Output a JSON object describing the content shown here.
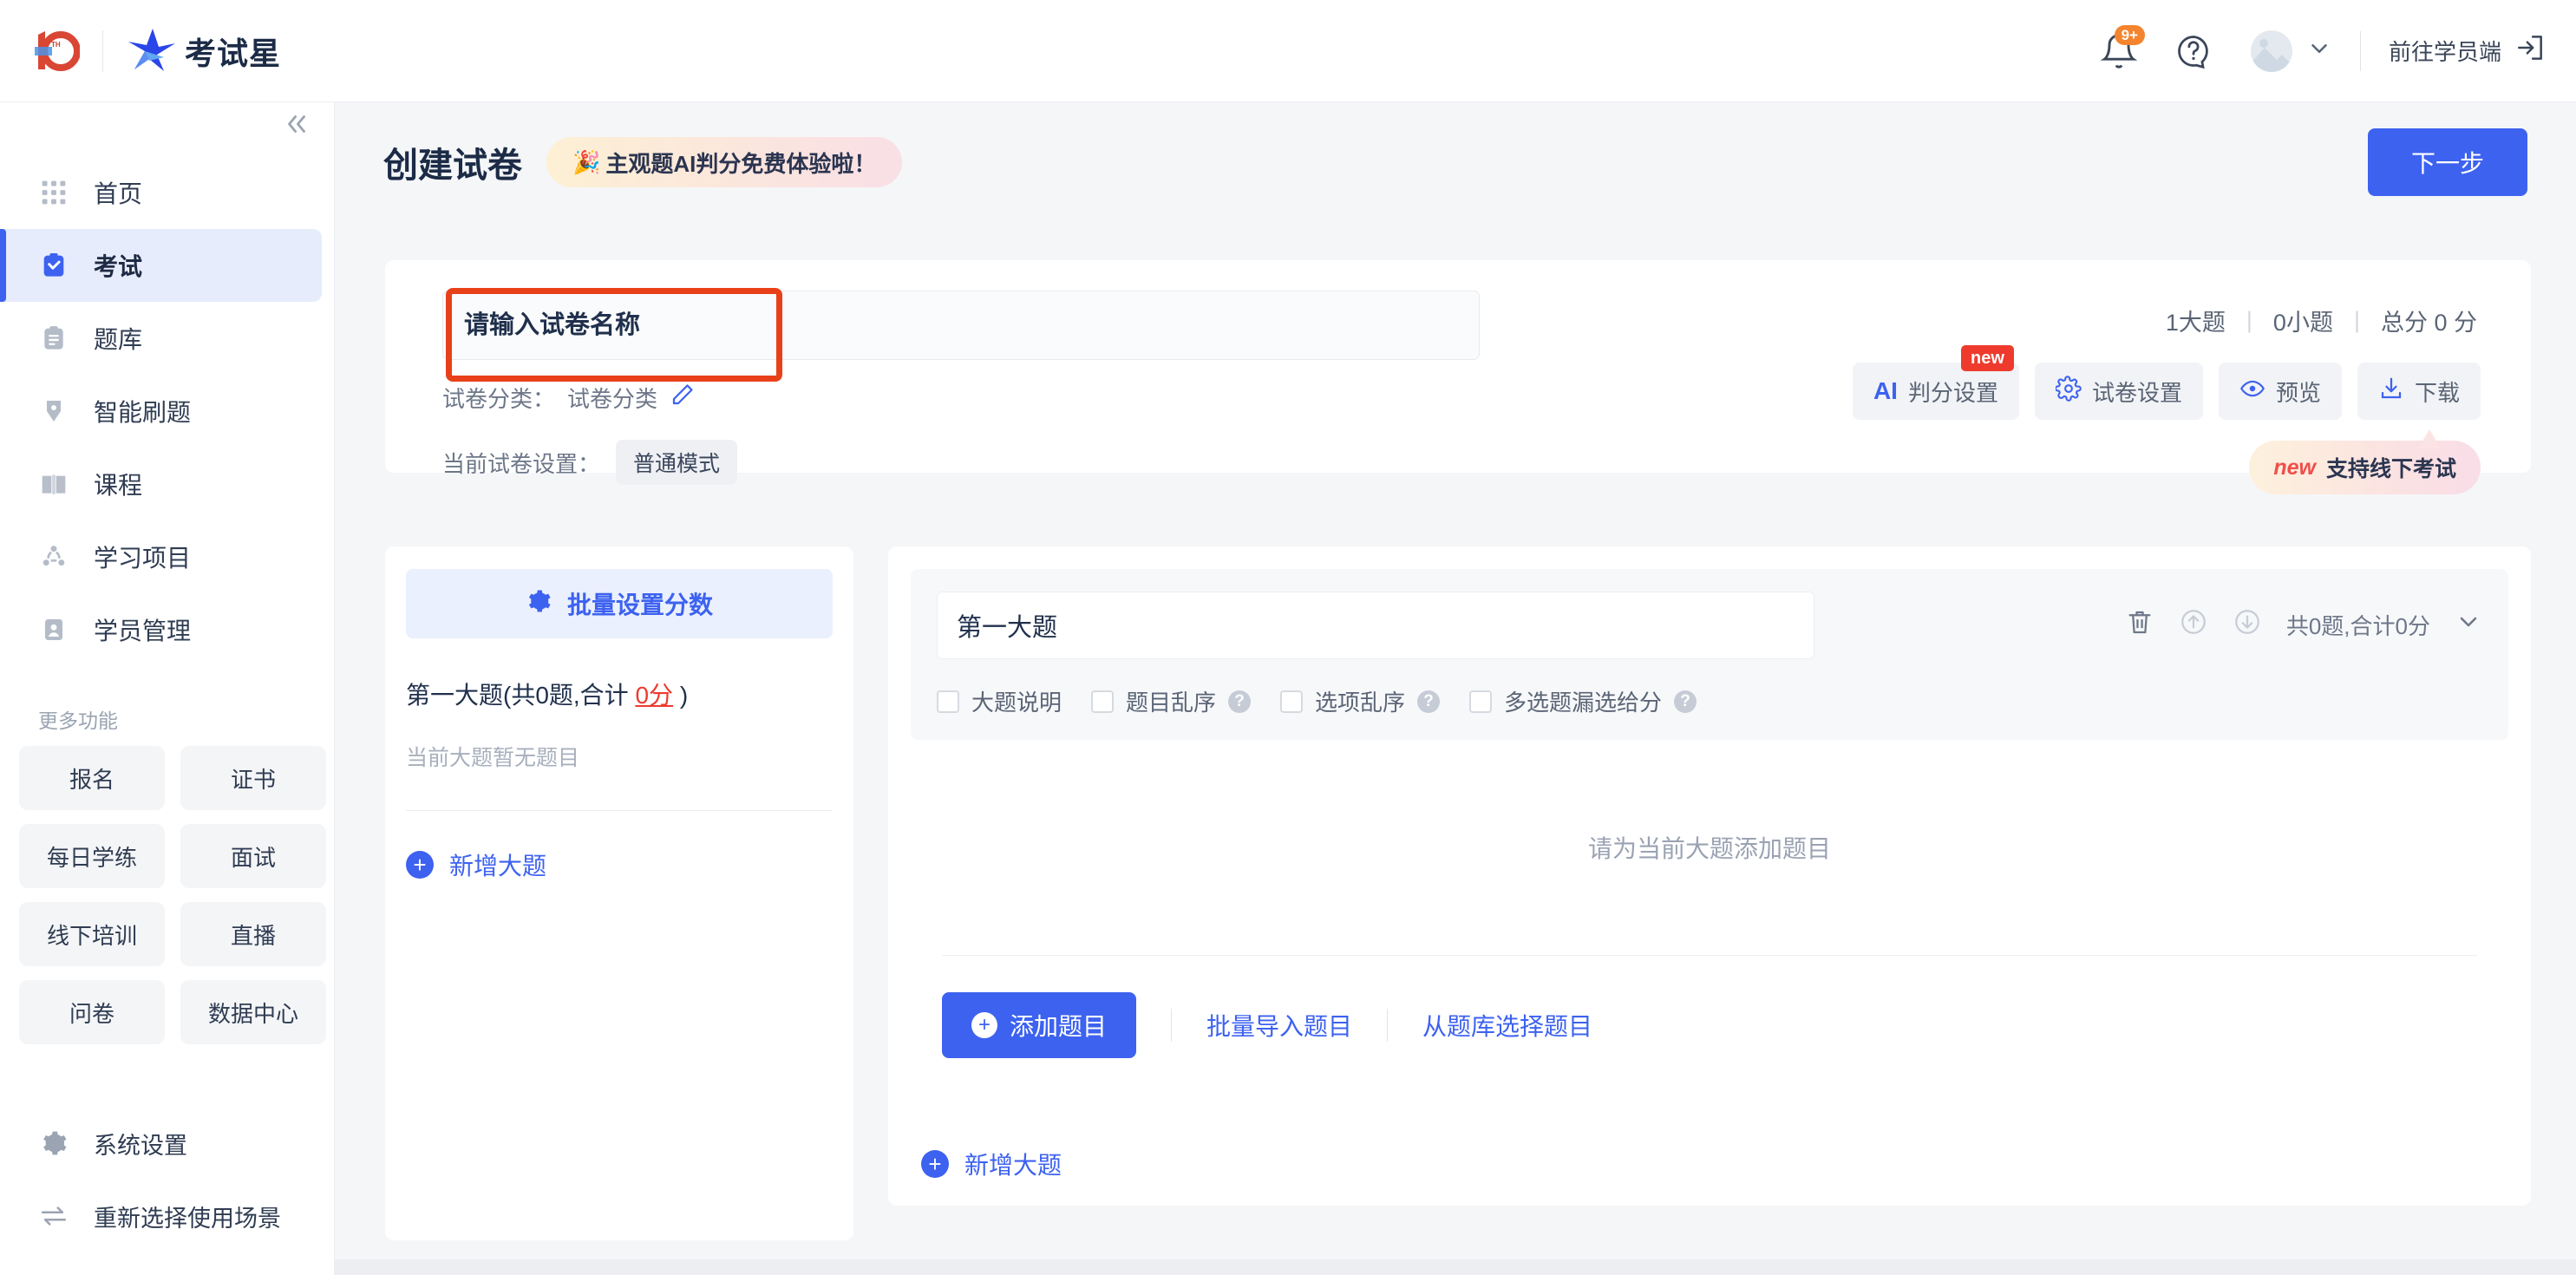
{
  "header": {
    "brand_name": "考试星",
    "logo_anniversary": "10",
    "logo_anniversary_sup": "TH",
    "notification_badge": "9+",
    "notification_icon": "bell-icon",
    "help_icon": "question-circle-icon",
    "avatar_icon": "avatar-placeholder",
    "account_chevron_icon": "chevron-down-icon",
    "goto_student_label": "前往学员端",
    "goto_student_icon": "exit-icon"
  },
  "sidebar": {
    "collapse_icon": "double-chevron-left-icon",
    "items": [
      {
        "label": "首页",
        "icon": "grid-icon",
        "active": false
      },
      {
        "label": "考试",
        "icon": "clipboard-check-icon",
        "active": true
      },
      {
        "label": "题库",
        "icon": "clipboard-lines-icon",
        "active": false
      },
      {
        "label": "智能刷题",
        "icon": "pen-nib-icon",
        "active": false
      },
      {
        "label": "课程",
        "icon": "book-open-icon",
        "active": false
      },
      {
        "label": "学习项目",
        "icon": "share-nodes-icon",
        "active": false
      },
      {
        "label": "学员管理",
        "icon": "id-card-icon",
        "active": false
      }
    ],
    "more_title": "更多功能",
    "chips": [
      "报名",
      "证书",
      "每日学练",
      "面试",
      "线下培训",
      "直播",
      "问卷",
      "数据中心"
    ],
    "bottom_links": [
      {
        "label": "系统设置",
        "icon": "gear-icon"
      },
      {
        "label": "重新选择使用场景",
        "icon": "swap-arrows-icon"
      }
    ]
  },
  "page": {
    "title": "创建试卷",
    "promo_icon": "party-popper-icon",
    "promo_text": "主观题AI判分免费体验啦！",
    "next_button": "下一步"
  },
  "paper": {
    "name_value": "",
    "name_placeholder": "请输入试卷名称",
    "category_label": "试卷分类：",
    "category_value": "试卷分类",
    "category_edit_icon": "pencil-icon",
    "settings_label": "当前试卷设置：",
    "settings_mode": "普通模式",
    "stats": {
      "sections": "1大题",
      "questions": "0小题",
      "total": "总分 0 分",
      "separator": "|"
    },
    "tools": [
      {
        "label": "判分设置",
        "icon": "ai-mark",
        "prefix": "AI",
        "badge": "new"
      },
      {
        "label": "试卷设置",
        "icon": "gear-icon",
        "prefix": "",
        "badge": ""
      },
      {
        "label": "预览",
        "icon": "eye-icon",
        "prefix": "",
        "badge": ""
      },
      {
        "label": "下载",
        "icon": "download-icon",
        "prefix": "",
        "badge": ""
      }
    ],
    "tip_new": "new",
    "tip_text": "支持线下考试"
  },
  "outline": {
    "batch_label": "批量设置分数",
    "batch_icon": "gear-icon",
    "section_head_prefix": "第一大题(共0题,合计 ",
    "section_head_score": "0分",
    "section_head_suffix": " )",
    "empty_text": "当前大题暂无题目",
    "add_section_label": "新增大题",
    "add_section_icon": "plus-circle-icon"
  },
  "editor": {
    "section_title_value": "第一大题",
    "delete_icon": "trash-icon",
    "move_up_icon": "arrow-up-circle-icon",
    "move_down_icon": "arrow-down-circle-icon",
    "section_summary": "共0题,合计0分",
    "collapse_icon": "chevron-down-icon",
    "checkboxes": [
      {
        "label": "大题说明",
        "help": false
      },
      {
        "label": "题目乱序",
        "help": true
      },
      {
        "label": "选项乱序",
        "help": true
      },
      {
        "label": "多选题漏选给分",
        "help": true
      }
    ],
    "empty_text": "请为当前大题添加题目",
    "add_question_label": "添加题目",
    "add_question_icon": "plus-circle-icon",
    "import_label": "批量导入题目",
    "from_bank_label": "从题库选择题目",
    "add_section_label": "新增大题",
    "add_section_icon": "plus-circle-icon"
  },
  "colors": {
    "brand_blue": "#3d62f0",
    "accent_red": "#ee3b2e",
    "annotation_red": "#e8411a",
    "badge_orange": "#f5842e",
    "page_bg": "#f5f6f8"
  }
}
